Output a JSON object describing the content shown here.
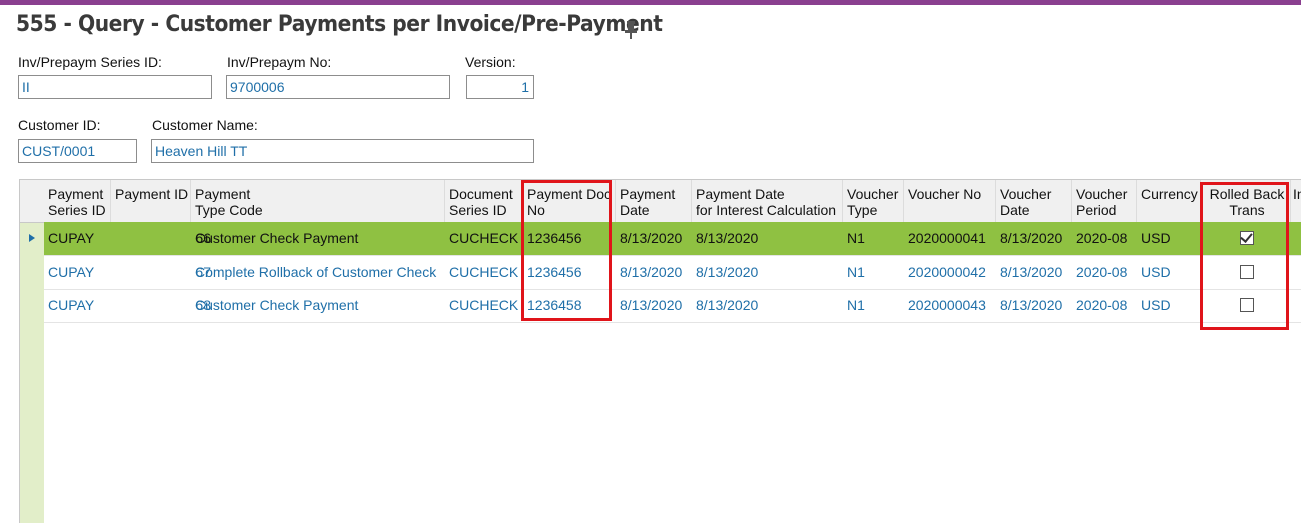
{
  "page": {
    "title": "555 - Query - Customer Payments per Invoice/Pre-Payment",
    "pin_icon": "pin-icon"
  },
  "filters": {
    "series_label": "Inv/Prepaym Series ID:",
    "series_value": "II",
    "number_label": "Inv/Prepaym No:",
    "number_value": "9700006",
    "version_label": "Version:",
    "version_value": "1",
    "customer_id_label": "Customer ID:",
    "customer_id_value": "CUST/0001",
    "customer_name_label": "Customer Name:",
    "customer_name_value": "Heaven Hill TT"
  },
  "grid": {
    "columns": [
      "Payment\nSeries ID",
      "Payment ID",
      "Payment\nType Code",
      "Document\nSeries ID",
      "Payment Doc\nNo",
      "Payment\nDate",
      "Payment Date\nfor Interest Calculation",
      "Voucher\nType",
      "Voucher No",
      "Voucher\nDate",
      "Voucher\nPeriod",
      "Currency",
      "Rolled Back\nTrans",
      "In"
    ],
    "rows": [
      {
        "series": "CUPAY",
        "id": "66",
        "type": "Customer Check Payment",
        "doc_series": "CUCHECK",
        "doc_no": "1236456",
        "date": "8/13/2020",
        "interest_date": "8/13/2020",
        "voucher_type": "N1",
        "voucher_no": "2020000041",
        "voucher_date": "8/13/2020",
        "period": "2020-08",
        "currency": "USD",
        "rolled_back": true
      },
      {
        "series": "CUPAY",
        "id": "67",
        "type": "Complete Rollback of Customer Check",
        "doc_series": "CUCHECK",
        "doc_no": "1236456",
        "date": "8/13/2020",
        "interest_date": "8/13/2020",
        "voucher_type": "N1",
        "voucher_no": "2020000042",
        "voucher_date": "8/13/2020",
        "period": "2020-08",
        "currency": "USD",
        "rolled_back": false
      },
      {
        "series": "CUPAY",
        "id": "68",
        "type": "Customer Check Payment",
        "doc_series": "CUCHECK",
        "doc_no": "1236458",
        "date": "8/13/2020",
        "interest_date": "8/13/2020",
        "voucher_type": "N1",
        "voucher_no": "2020000043",
        "voucher_date": "8/13/2020",
        "period": "2020-08",
        "currency": "USD",
        "rolled_back": false
      }
    ]
  },
  "colors": {
    "accent_bar": "#8a3f8f",
    "selected_row": "#8fc142",
    "link_text": "#1f6fa8",
    "highlight_box": "#e0141a"
  }
}
